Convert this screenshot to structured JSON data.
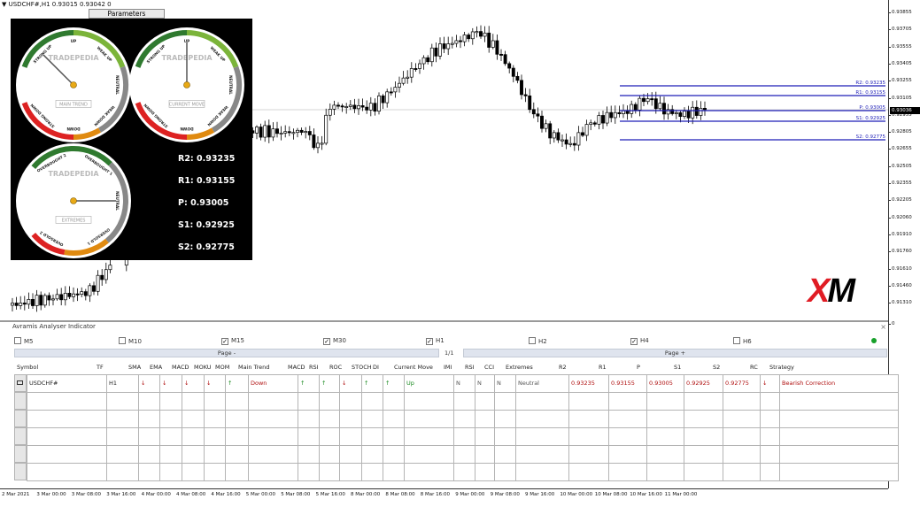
{
  "window": {
    "symbol_label": "▼ USDCHF#,H1  0.93015 0.93042 0"
  },
  "toolbar": {
    "parameters_label": "Parameters"
  },
  "dashboard": {
    "brand": "TRADEPEDIA",
    "gauges": [
      {
        "caption": "MAIN TREND",
        "labels": [
          "UP",
          "WEAK UP",
          "NEUTRAL",
          "WEAK DOWN",
          "DOWN",
          "STRONG DOWN",
          "STRONG UP"
        ]
      },
      {
        "caption": "CURRENT MOVE",
        "labels": [
          "UP",
          "WEAK UP",
          "NEUTRAL",
          "WEAK DOWN",
          "DOWN",
          "STRONG DOWN",
          "STRONG UP"
        ]
      },
      {
        "caption": "EXTREMES",
        "labels": [
          "OVERBOUGHT 2",
          "OVERBOUGHT 1",
          "NEUTRAL",
          "OVERSOLD 1",
          "OVERSOLD 2"
        ]
      }
    ],
    "pivots": {
      "r2": "R2: 0.93235",
      "r1": "R1: 0.93155",
      "p": "P:  0.93005",
      "s1": "S1: 0.92925",
      "s2": "S2: 0.92775"
    }
  },
  "chart_lines": {
    "r2": "R2: 0.93235",
    "r1": "R1: 0.93155",
    "p": "P: 0.93005",
    "s1": "S1: 0.92925",
    "s2": "S2: 0.92775"
  },
  "price_axis": {
    "ticks": [
      "0.93855",
      "0.93705",
      "0.93555",
      "0.93405",
      "0.93255",
      "0.93105",
      "0.92955",
      "0.92805",
      "0.92655",
      "0.92505",
      "0.92355",
      "0.92205",
      "0.92060",
      "0.91910",
      "0.91760",
      "0.91610",
      "0.91460",
      "0.91310"
    ],
    "current_price": "0.93036",
    "sub_ticks": [
      "0",
      "0"
    ]
  },
  "time_axis": {
    "ticks": [
      "2 Mar 2021",
      "3 Mar 00:00",
      "3 Mar 08:00",
      "3 Mar 16:00",
      "4 Mar 00:00",
      "4 Mar 08:00",
      "4 Mar 16:00",
      "5 Mar 00:00",
      "5 Mar 08:00",
      "5 Mar 16:00",
      "8 Mar 00:00",
      "8 Mar 08:00",
      "8 Mar 16:00",
      "9 Mar 00:00",
      "9 Mar 08:00",
      "9 Mar 16:00",
      "10 Mar 00:00",
      "10 Mar 08:00",
      "10 Mar 16:00",
      "11 Mar 00:00"
    ]
  },
  "indicator": {
    "title": "Avramis Analyser Indicator",
    "close_label": "×",
    "timeframes": [
      {
        "label": "M5",
        "checked": false
      },
      {
        "label": "M10",
        "checked": false
      },
      {
        "label": "M15",
        "checked": true
      },
      {
        "label": "M30",
        "checked": true
      },
      {
        "label": "H1",
        "checked": true
      },
      {
        "label": "H2",
        "checked": false
      },
      {
        "label": "H4",
        "checked": true
      },
      {
        "label": "H6",
        "checked": false
      }
    ],
    "check_glyph": "✓",
    "page_minus": "Page -",
    "page_plus": "Page +",
    "page_count": "1/1",
    "headers": [
      "Symbol",
      "TF",
      "SMA",
      "EMA",
      "MACD",
      "MOKU",
      "MOM",
      "Main Trend",
      "MACD",
      "RSI",
      "ROC",
      "STOCH",
      "DI",
      "Current Move",
      "IMI",
      "RSI",
      "CCI",
      "Extremes",
      "R2",
      "R1",
      "P",
      "S1",
      "S2",
      "RC",
      "Strategy"
    ],
    "row": {
      "symbol": "USDCHF#",
      "tf": "H1",
      "sma": "↓",
      "ema": "↓",
      "macd": "↓",
      "moku": "↓",
      "mom": "↑",
      "main_trend": "Down",
      "macd2": "↑",
      "rsi": "↑",
      "roc": "↓",
      "stoch": "↑",
      "di": "↑",
      "current_move": "Up",
      "imi": "N",
      "rsi2": "N",
      "cci": "N",
      "extremes": "Neutral",
      "r2": "0.93235",
      "r1": "0.93155",
      "p": "0.93005",
      "s1": "0.92925",
      "s2": "0.92775",
      "rc": "↓",
      "strategy": "Bearish Correction"
    }
  },
  "brand_logo": {
    "text": "XM",
    "accent": "#e01c24"
  },
  "colors": {
    "pivot_line": "#1f1fb8",
    "bull": "#ffffff",
    "bear": "#000000",
    "down": "#b01010",
    "up": "#1a8a20"
  }
}
